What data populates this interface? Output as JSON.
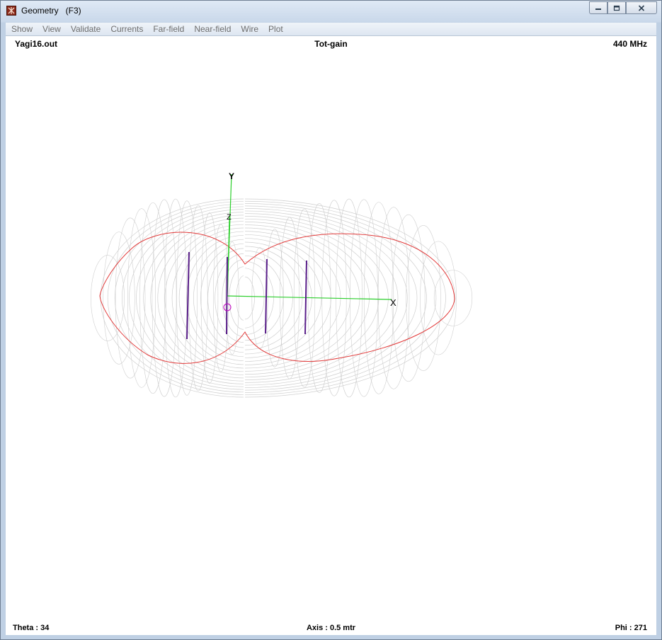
{
  "window": {
    "title": "Geometry   (F3)",
    "icon": "antenna-app-icon",
    "controls": [
      "minimize-icon",
      "restore-icon",
      "close-icon"
    ]
  },
  "menu": {
    "items": [
      "Show",
      "View",
      "Validate",
      "Currents",
      "Far-field",
      "Near-field",
      "Wire",
      "Plot"
    ]
  },
  "plot": {
    "file": "Yagi16.out",
    "mode": "Tot-gain",
    "frequency": "440 MHz",
    "theta": "Theta : 34",
    "axis": "Axis : 0.5 mtr",
    "phi": "Phi : 271",
    "axis_labels": {
      "x": "X",
      "y": "Y",
      "z": "Z"
    },
    "colors": {
      "mesh": "#cfcfcf",
      "slice": "#e23a3a",
      "axes": "#2ccf2c",
      "elements": "#5a1f8a",
      "feed": "#c000c0"
    }
  }
}
